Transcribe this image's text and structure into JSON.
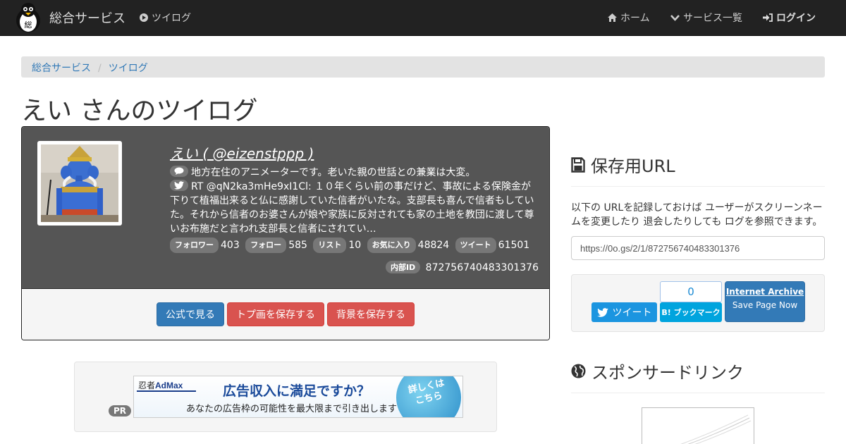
{
  "navbar": {
    "brand": "総合サービス",
    "twilog_link": "ツイログ",
    "home": "ホーム",
    "services": "サービス一覧",
    "login": "ログイン"
  },
  "breadcrumb": [
    "総合サービス",
    "ツイログ"
  ],
  "page_title": "えい さんのツイログ",
  "profile": {
    "name": "えい ( @eizenstppp )",
    "bio": "地方在住のアニメーターです。老いた親の世話との兼業は大変。",
    "latest_tweet": "RT @qN2ka3mHe9xI1Cl: １０年くらい前の事だけど、事故による保険金が下りて植福出来ると仏に感謝していた信者がいたな。支部長も喜んで信者も󠄀していた。それから信者のお婆さんが娘や家族に反対されても家の土地を教団に渡して尊いお布施だと言われ支部長と信者に󠄀されてい…",
    "stats": [
      {
        "label": "フォロワー",
        "value": "403"
      },
      {
        "label": "フォロー",
        "value": "585"
      },
      {
        "label": "リスト",
        "value": "10"
      },
      {
        "label": "お気に入り",
        "value": "48824"
      },
      {
        "label": "ツイート",
        "value": "61501"
      }
    ],
    "internal_id_label": "内部ID",
    "internal_id": "872756740483301376"
  },
  "actions": {
    "official": "公式で見る",
    "save_avatar": "トプ画を保存する",
    "save_bg": "背景を保存する"
  },
  "pr": {
    "label": "PR",
    "ad_brand_a": "忍者",
    "ad_brand_b": "AdMax",
    "ad_main": "広告収入に満足ですか？",
    "ad_sub": "あなたの広告枠の可能性を最大限まで引き出します",
    "ad_cta_1": "詳しくは",
    "ad_cta_2": "こちら"
  },
  "save_url": {
    "heading": "保存用URL",
    "description": "以下の URLを記録しておけば ユーザーがスクリーンネームを変更したり 退会したりしても ログを参照できます。",
    "url": "https://0o.gs/2/1/872756740483301376"
  },
  "share": {
    "tweet": "ツイート",
    "hatena_count": "0",
    "hatena_label": "B! ブックマーク",
    "ia_title": "Internet Archive",
    "ia_sub": "Save Page Now"
  },
  "sponsor": {
    "heading": "スポンサードリンク"
  },
  "colors": {
    "navbar": "#222222",
    "primary": "#337ab7",
    "danger": "#d9534f",
    "twitter": "#1b95e0",
    "hatena": "#00a4de"
  }
}
